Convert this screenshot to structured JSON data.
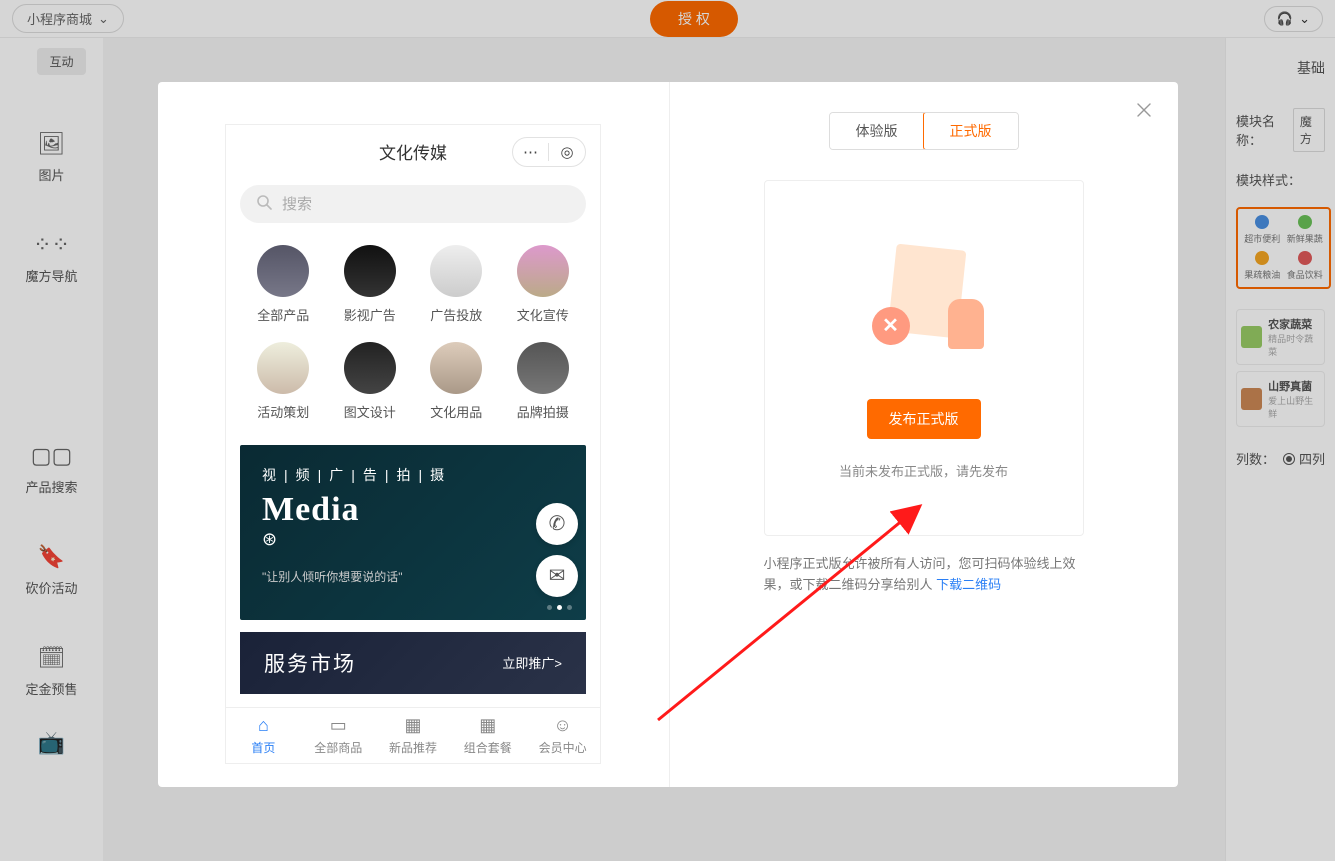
{
  "topbar": {
    "shop_name": "小程序商城",
    "auth_btn": "授 权"
  },
  "left_rail": {
    "pill": "互动",
    "items": [
      {
        "label": "图片"
      },
      {
        "label": "魔方导航"
      },
      {
        "label": "产品搜索"
      },
      {
        "label": "砍价活动"
      },
      {
        "label": "定金预售"
      }
    ]
  },
  "right_panel": {
    "tab": "基础",
    "name_label": "模块名称：",
    "name_value": "魔方",
    "style_label": "模块样式：",
    "styles": [
      {
        "label": "超市便利",
        "color": "#4a90e2"
      },
      {
        "label": "新鲜果蔬",
        "color": "#6ac259"
      },
      {
        "label": "果疏粮油",
        "color": "#f5a623"
      },
      {
        "label": "食品饮料",
        "color": "#e05a5a"
      }
    ],
    "list": [
      {
        "title": "农家蔬菜",
        "sub": "精品时令蔬菜"
      },
      {
        "title": "山野真菌",
        "sub": "爱上山野生鲜"
      }
    ],
    "cols_label": "列数：",
    "cols_value": "四列"
  },
  "modal": {
    "phone": {
      "title": "文化传媒",
      "search_placeholder": "搜索",
      "categories": [
        "全部产品",
        "影视广告",
        "广告投放",
        "文化宣传",
        "活动策划",
        "图文设计",
        "文化用品",
        "品牌拍摄"
      ],
      "banner": {
        "sub": "视|频|广|告|拍|摄",
        "title": "Media",
        "quote": "\"让别人倾听你想要说的话\""
      },
      "service": {
        "title": "服务市场",
        "go": "立即推广>"
      },
      "tabs": [
        {
          "label": "首页",
          "active": true
        },
        {
          "label": "全部商品"
        },
        {
          "label": "新品推荐"
        },
        {
          "label": "组合套餐"
        },
        {
          "label": "会员中心"
        }
      ]
    },
    "publish": {
      "ver_tabs": [
        {
          "label": "体验版"
        },
        {
          "label": "正式版",
          "active": true
        }
      ],
      "btn": "发布正式版",
      "msg": "当前未发布正式版，请先发布",
      "desc_a": "小程序正式版允许被所有人访问，您可扫码体验线上效果，或下载二维码分享给别人 ",
      "desc_link": "下载二维码"
    }
  }
}
